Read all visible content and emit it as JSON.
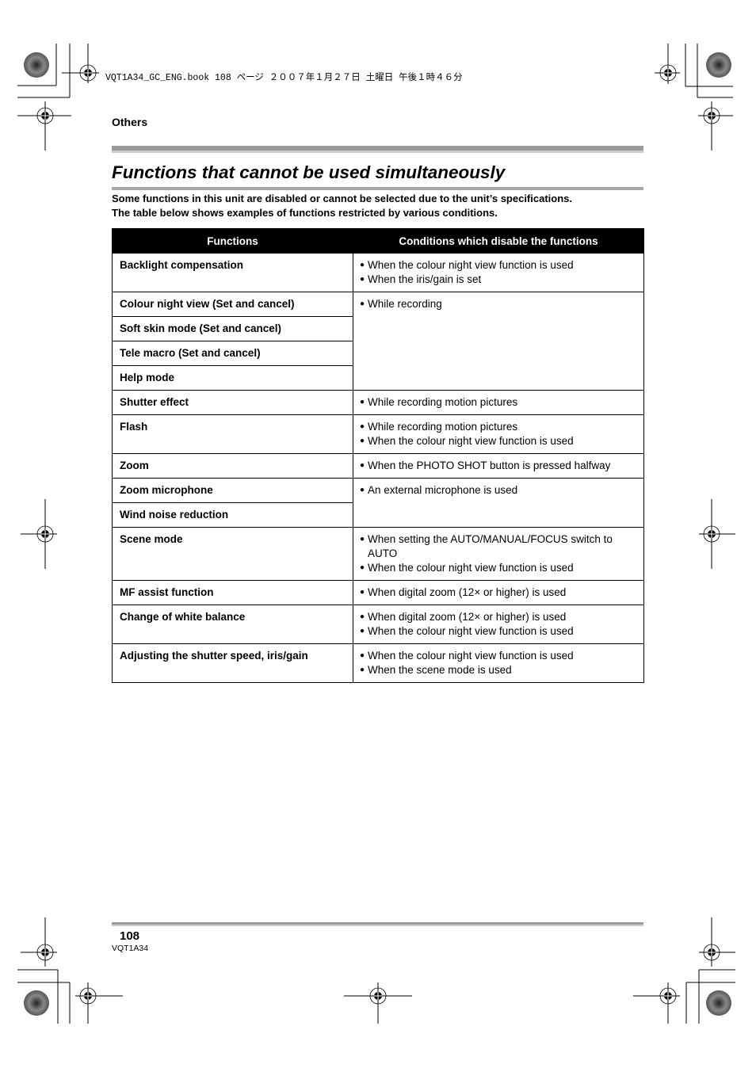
{
  "print_header": "VQT1A34_GC_ENG.book  108 ページ  ２００７年１月２７日  土曜日  午後１時４６分",
  "section_label": "Others",
  "title": "Functions that cannot be used simultaneously",
  "intro": [
    "Some functions in this unit are disabled or cannot be selected due to the unit’s specifications.",
    "The table below shows examples of functions restricted by various conditions."
  ],
  "table": {
    "headers": [
      "Functions",
      "Conditions which disable the functions"
    ],
    "bullet": "●",
    "rows": [
      {
        "function": "Backlight compensation",
        "conditions": [
          "When the colour night view function is used",
          "When the iris/gain is set"
        ]
      },
      {
        "function": "Colour night view (Set and cancel)",
        "conditions": [
          "While recording"
        ]
      },
      {
        "function": "Soft skin mode (Set and cancel)"
      },
      {
        "function": "Tele macro (Set and cancel)"
      },
      {
        "function": "Help mode"
      },
      {
        "function": "Shutter effect",
        "conditions": [
          "While recording motion pictures"
        ]
      },
      {
        "function": "Flash",
        "conditions": [
          "While recording motion pictures",
          "When the colour night view function is used"
        ]
      },
      {
        "function": "Zoom",
        "conditions": [
          "When the PHOTO SHOT button is pressed halfway"
        ]
      },
      {
        "function": "Zoom microphone",
        "conditions": [
          "An external microphone is used"
        ]
      },
      {
        "function": "Wind noise reduction"
      },
      {
        "function": "Scene mode",
        "conditions": [
          "When setting the AUTO/MANUAL/FOCUS switch to AUTO",
          "When the colour night view function is used"
        ]
      },
      {
        "function": "MF assist function",
        "conditions": [
          "When digital zoom (12× or higher) is used"
        ]
      },
      {
        "function": "Change of white balance",
        "conditions": [
          "When digital zoom (12× or higher) is used",
          "When the colour night view function is used"
        ]
      },
      {
        "function": "Adjusting the shutter speed, iris/gain",
        "conditions": [
          "When the colour night view function is used",
          "When the scene mode is used"
        ]
      }
    ]
  },
  "footer": {
    "page_number": "108",
    "doc_code": "VQT1A34"
  },
  "colors": {
    "header_bg": "#000000",
    "rule_gray": "#9a9a9a",
    "rule_light": "#cccccc"
  }
}
